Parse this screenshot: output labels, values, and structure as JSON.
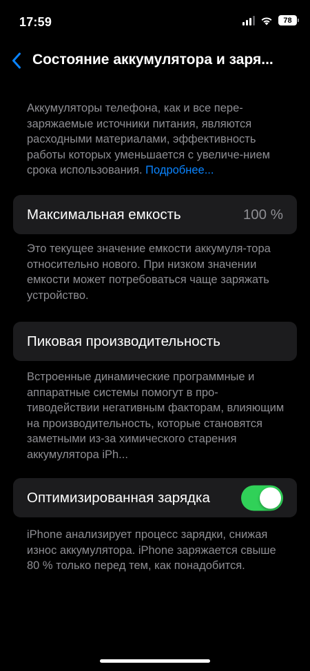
{
  "status_bar": {
    "time": "17:59",
    "battery_level": "78"
  },
  "nav": {
    "title": "Состояние аккумулятора и заря..."
  },
  "intro": {
    "text": "Аккумуляторы телефона, как и все пере-заряжаемые источники питания, являются расходными материалами, эффективность работы которых уменьшается с увеличе-нием срока использования. ",
    "link": "Подробнее..."
  },
  "max_capacity": {
    "label": "Максимальная емкость",
    "value": "100 %",
    "description": "Это текущее значение емкости аккумуля-тора относительно нового. При низком значении емкости может потребоваться чаще заряжать устройство."
  },
  "peak_performance": {
    "label": "Пиковая производительность",
    "description": "Встроенные динамические программные и аппаратные системы помогут в про-тиводействии негативным факторам, влияющим на производительность, которые становятся заметными из-за химического старения аккумулятора iPh..."
  },
  "optimized_charging": {
    "label": "Оптимизированная зарядка",
    "enabled": true,
    "description": "iPhone анализирует процесс зарядки, снижая износ аккумулятора. iPhone заряжается свыше 80 % только перед тем, как понадобится."
  },
  "colors": {
    "background": "#000000",
    "card": "#1c1c1e",
    "secondary_text": "#8e8e93",
    "link": "#0a84ff",
    "toggle_on": "#30d158"
  }
}
